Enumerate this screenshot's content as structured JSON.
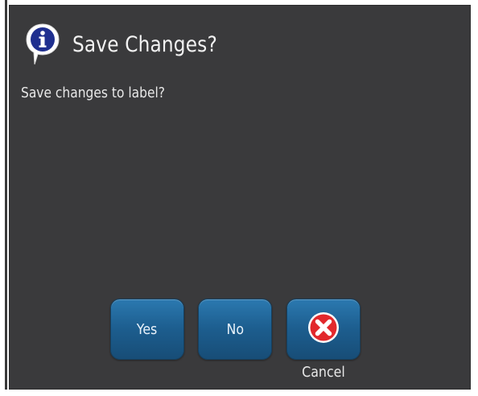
{
  "dialog": {
    "title": "Save Changes?",
    "title_icon": "info-icon",
    "message": "Save changes to label?"
  },
  "buttons": {
    "yes_label": "Yes",
    "no_label": "No",
    "cancel_icon": "close-icon",
    "cancel_label": "Cancel"
  },
  "colors": {
    "dialog_background": "#3a3a3c",
    "button_blue": "#1d5e8f",
    "cancel_red": "#e2282c",
    "info_blue": "#1f2f8f"
  }
}
